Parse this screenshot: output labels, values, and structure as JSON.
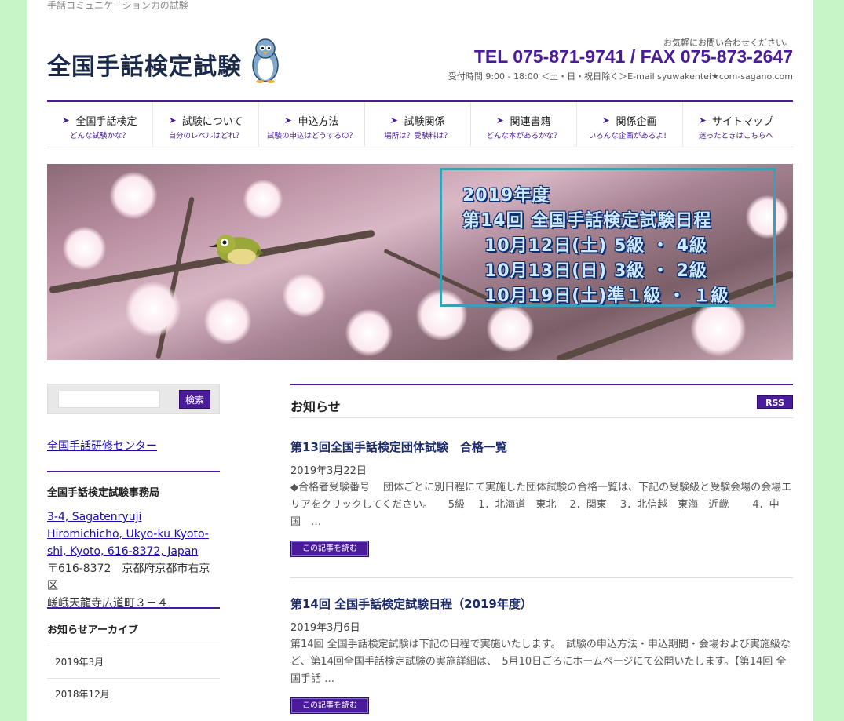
{
  "site": {
    "tagline": "手話コミュニケーション力の試験",
    "logo_text": "全国手話検定試験"
  },
  "contact": {
    "note": "お気軽にお問い合わせください。",
    "tel_fax": "TEL 075-871-9741 / FAX 075-873-2647",
    "hours": "受付時間 9:00 - 18:00 ＜土・日・祝日除く＞E-mail syuwakentei★com-sagano.com"
  },
  "nav": {
    "items": [
      {
        "label": "全国手話検定",
        "sub": "どんな試験かな？"
      },
      {
        "label": "試験について",
        "sub": "自分のレベルはどれ？"
      },
      {
        "label": "申込方法",
        "sub": "試験の申込はどうするの？"
      },
      {
        "label": "試験関係",
        "sub": "場所は？受験料は？"
      },
      {
        "label": "関連書籍",
        "sub": "どんな本があるかな？"
      },
      {
        "label": "関係企画",
        "sub": "いろんな企画があるよ！"
      },
      {
        "label": "サイトマップ",
        "sub": "迷ったときはこちらへ"
      }
    ]
  },
  "banner": {
    "lines": [
      "2019年度",
      "第14回 全国手話検定試験日程",
      "10月12日(土) 5級 ・ 4級",
      "10月13日(日) 3級 ・ 2級",
      "10月19日(土)準１級 ・ １級"
    ]
  },
  "sidebar": {
    "search_button": "検索",
    "search_placeholder": "",
    "link": "全国手話研修センター",
    "office_title": "全国手話検定試験事務局",
    "address_en": "3-4, Sagatenryuji Hiromichicho, Ukyo-ku Kyoto-shi, Kyoto, 616-8372, Japan",
    "address_jp_1": "〒616-8372　京都府京都市右京区",
    "address_jp_2": "嵯峨天龍寺広道町３－４",
    "archive_title": "お知らせアーカイブ",
    "archive": [
      "2019年3月",
      "2018年12月"
    ]
  },
  "news": {
    "title": "お知らせ",
    "rss": "RSS",
    "read_more": "この記事を読む",
    "articles": [
      {
        "title": "第13回全国手話検定団体試験　合格一覧",
        "date": "2019年3月22日",
        "body": "◆合格者受験番号　 団体ごとに別日程にて実施した団体試験の合格一覧は、下記の受験級と受験会場の会場エリアをクリックしてください。　　5級　 1．北海道　東北　 2．関東　 3．北信越　東海　近畿　　 4．中国　…"
      },
      {
        "title": "第14回 全国手話検定試験日程（2019年度）",
        "date": "2019年3月6日",
        "body": "第14回 全国手話検定試験は下記の日程で実施いたします。　試験の申込方法・申込期間・会場および実施級など、第14回全国手話検定試験の実施詳細は、　5月10日ごろにホームページにて公開いたします。【第14回 全国手話 …"
      }
    ]
  },
  "colors": {
    "accent": "#4a1c9a",
    "background": "#c8f5c8",
    "banner_frame": "#3aa0b8"
  }
}
